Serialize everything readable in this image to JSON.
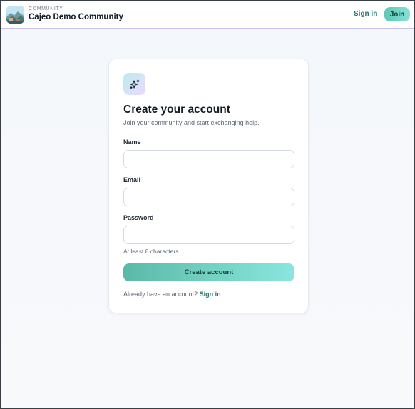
{
  "header": {
    "logo_icon": "community-logo-icon",
    "community_label": "COMMUNITY",
    "community_name": "Cajeo Demo Community",
    "signin_label": "Sign in",
    "join_label": "Join"
  },
  "card": {
    "icon": "sparkles-icon",
    "title": "Create your account",
    "subtitle": "Join your community and start exchanging help.",
    "fields": {
      "name": {
        "label": "Name",
        "value": "",
        "placeholder": ""
      },
      "email": {
        "label": "Email",
        "value": "",
        "placeholder": ""
      },
      "password": {
        "label": "Password",
        "value": "",
        "placeholder": ""
      }
    },
    "password_hint": "At least 8 characters.",
    "submit_label": "Create account",
    "footer_text": "Already have an account?",
    "footer_link": "Sign in"
  },
  "colors": {
    "accent": "#23756e",
    "button_gradient_start": "#5ab9a7",
    "button_gradient_end": "#8ae6de",
    "header_border": "#c9c1ef"
  }
}
